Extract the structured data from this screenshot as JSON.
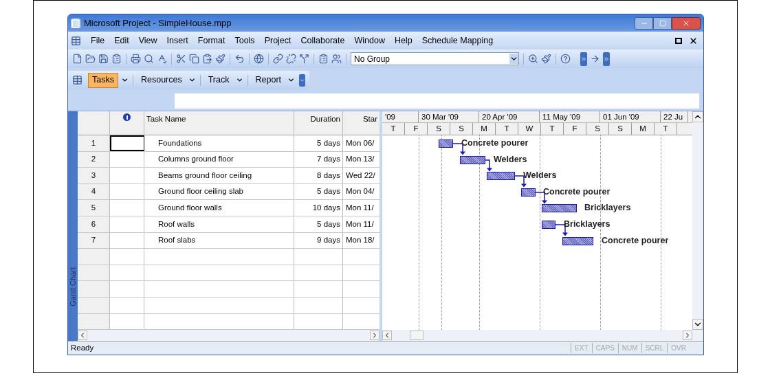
{
  "window": {
    "title": "Microsoft Project - SimpleHouse.mpp"
  },
  "menu": [
    "File",
    "Edit",
    "View",
    "Insert",
    "Format",
    "Tools",
    "Project",
    "Collaborate",
    "Window",
    "Help",
    "Schedule Mapping"
  ],
  "toolbar": {
    "group_select": {
      "value": "No Group"
    }
  },
  "view_bar": [
    {
      "label": "Tasks",
      "selected": true
    },
    {
      "label": "Resources",
      "selected": false
    },
    {
      "label": "Track",
      "selected": false
    },
    {
      "label": "Report",
      "selected": false
    }
  ],
  "view_label": "Gantt Chart",
  "table": {
    "columns": [
      "Task Name",
      "Duration",
      "Star"
    ],
    "rows": [
      {
        "id": "1",
        "name": "Foundations",
        "duration": "5 days",
        "start": "Mon 06/",
        "resource": "Concrete pourer",
        "selected": true
      },
      {
        "id": "2",
        "name": "Columns ground floor",
        "duration": "7 days",
        "start": "Mon 13/",
        "resource": "Welders",
        "selected": false
      },
      {
        "id": "3",
        "name": "Beams ground floor ceiling",
        "duration": "8 days",
        "start": "Wed 22/",
        "resource": "Welders",
        "selected": false
      },
      {
        "id": "4",
        "name": "Ground floor ceiling slab",
        "duration": "5 days",
        "start": "Mon 04/",
        "resource": "Concrete pourer",
        "selected": false
      },
      {
        "id": "5",
        "name": "Ground floor walls",
        "duration": "10 days",
        "start": "Mon 11/",
        "resource": "Bricklayers",
        "selected": false
      },
      {
        "id": "6",
        "name": "Roof walls",
        "duration": "5 days",
        "start": "Mon 11/",
        "resource": "Bricklayers",
        "selected": false
      },
      {
        "id": "7",
        "name": "Roof slabs",
        "duration": "9 days",
        "start": "Mon 18/",
        "resource": "Concrete pourer",
        "selected": false
      }
    ]
  },
  "timescale": {
    "major": [
      "'09",
      "30 Mar '09",
      "20 Apr '09",
      "11 May '09",
      "01 Jun '09",
      "22 Ju"
    ],
    "minor": [
      "T",
      "F",
      "S",
      "S",
      "M",
      "T",
      "W",
      "T",
      "F",
      "S",
      "S",
      "M",
      "T"
    ]
  },
  "status_bar": {
    "text": "Ready",
    "indicators": [
      {
        "label": "EXT",
        "enabled": false
      },
      {
        "label": "CAPS",
        "enabled": false
      },
      {
        "label": "NUM",
        "enabled": false
      },
      {
        "label": "SCRL",
        "enabled": false
      },
      {
        "label": "OVR",
        "enabled": false
      }
    ]
  }
}
